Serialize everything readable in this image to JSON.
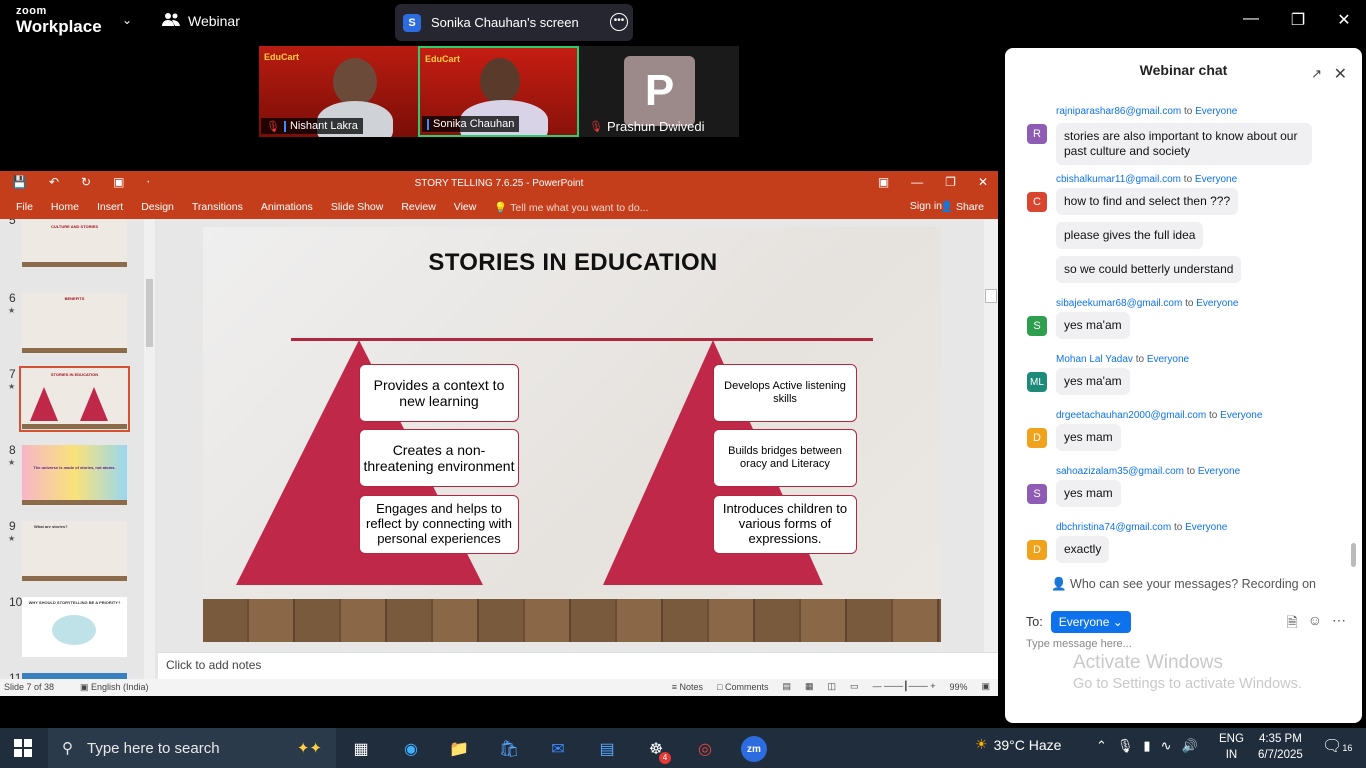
{
  "zoom": {
    "logo_top": "zoom",
    "logo_bottom": "Workplace",
    "webinar_label": "Webinar",
    "share_initial": "S",
    "share_label": "Sonika Chauhan's screen"
  },
  "participants": [
    {
      "brand": "EduCart",
      "name": "Nishant Lakra"
    },
    {
      "brand": "EduCart",
      "name": "Sonika Chauhan"
    },
    {
      "initial": "P",
      "name": "Prashun Dwivedi"
    }
  ],
  "ppt": {
    "window_title": "STORY TELLING 7.6.25  -  PowerPoint",
    "ribbon_tabs": [
      "File",
      "Home",
      "Insert",
      "Design",
      "Transitions",
      "Animations",
      "Slide Show",
      "Review",
      "View"
    ],
    "tell_me": "Tell me what you want to do...",
    "sign_in": "Sign in",
    "share": "Share",
    "thumbnails": [
      {
        "num": "5",
        "title": "CULTURE AND STORIES",
        "star": ""
      },
      {
        "num": "6",
        "title": "BENEFITS",
        "star": "★"
      },
      {
        "num": "7",
        "title": "STORIES IN EDUCATION",
        "star": "★"
      },
      {
        "num": "8",
        "title": "The universe is made of stories, not atoms.",
        "star": "★"
      },
      {
        "num": "9",
        "title": "What are stories?",
        "star": "★"
      },
      {
        "num": "10",
        "title": "WHY SHOULD STORYTELLING BE A PRIORITY?",
        "star": ""
      },
      {
        "num": "11",
        "title": "",
        "star": ""
      }
    ],
    "slide": {
      "title": "STORIES IN EDUCATION",
      "left_boxes": [
        "Provides a context to new learning",
        "Creates a non-threatening environment",
        "Engages and helps to reflect by connecting with personal experiences"
      ],
      "right_boxes": [
        "Develops Active listening skills",
        "Builds bridges between oracy and Literacy",
        "Introduces children to various forms of expressions."
      ]
    },
    "notes_placeholder": "Click to add notes",
    "status": {
      "slide_count": "Slide 7 of 38",
      "language": "English (India)",
      "notes": "Notes",
      "comments": "Comments",
      "zoom": "99%"
    }
  },
  "chat": {
    "title": "Webinar chat",
    "to_word": "to",
    "messages": [
      {
        "initial": "R",
        "color": "#8e5bb5",
        "sender": "rajniparashar86@gmail.com",
        "to": "Everyone",
        "texts": [
          "stories are also important to know about our past culture and society"
        ]
      },
      {
        "initial": "C",
        "color": "#d9462f",
        "sender": "cbishalkumar11@gmail.com",
        "to": "Everyone",
        "texts": [
          "how to find and select then ???",
          "please gives the full idea",
          "so we could betterly understand"
        ]
      },
      {
        "initial": "S",
        "color": "#2e9e4f",
        "sender": "sibajeekumar68@gmail.com",
        "to": "Everyone",
        "texts": [
          "yes ma'am"
        ]
      },
      {
        "initial": "ML",
        "color": "#1e8a7a",
        "sender": "Mohan Lal Yadav",
        "to": "Everyone",
        "texts": [
          "yes ma'am"
        ]
      },
      {
        "initial": "D",
        "color": "#f0a21c",
        "sender": "drgeetachauhan2000@gmail.com",
        "to": "Everyone",
        "texts": [
          "yes mam"
        ]
      },
      {
        "initial": "S",
        "color": "#8e5bb5",
        "sender": "sahoazizalam35@gmail.com",
        "to": "Everyone",
        "texts": [
          "yes mam"
        ]
      },
      {
        "initial": "D",
        "color": "#f0a21c",
        "sender": "dbchristina74@gmail.com",
        "to": "Everyone",
        "texts": [
          "exactly"
        ]
      }
    ],
    "who_can_see": "Who can see your messages? Recording on",
    "to_label": "To:",
    "to_value": "Everyone",
    "input_placeholder": "Type message here..."
  },
  "watermark": {
    "line1": "Activate Windows",
    "line2": "Go to Settings to activate Windows."
  },
  "taskbar": {
    "search_placeholder": "Type here to search",
    "weather": "39°C  Haze",
    "lang_top": "ENG",
    "lang_bottom": "IN",
    "time": "4:35 PM",
    "date": "6/7/2025",
    "notif_count": "16",
    "badge_count": "4"
  }
}
